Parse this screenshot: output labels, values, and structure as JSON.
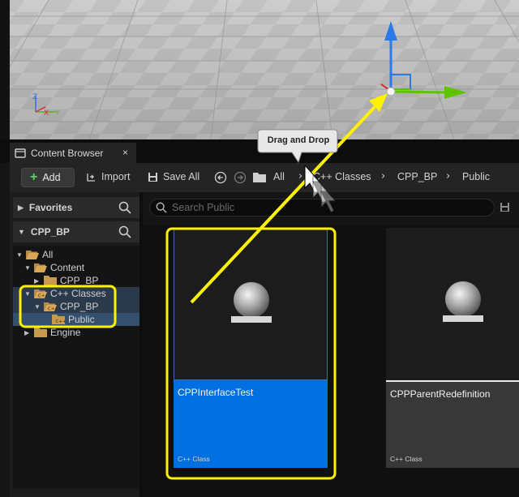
{
  "content_browser": {
    "tab_title": "Content Browser",
    "tab_close": "×"
  },
  "toolbar": {
    "add_label": "Add",
    "import_label": "Import",
    "save_all_label": "Save All",
    "breadcrumbs": [
      "All",
      "C++ Classes",
      "CPP_BP",
      "Public"
    ]
  },
  "sidebar": {
    "favorites_label": "Favorites",
    "project_label": "CPP_BP",
    "tree": [
      {
        "label": "All"
      },
      {
        "label": "Content"
      },
      {
        "label": "CPP_BP"
      },
      {
        "label": "C++ Classes"
      },
      {
        "label": "CPP_BP"
      },
      {
        "label": "Public"
      },
      {
        "label": "Engine"
      }
    ]
  },
  "search": {
    "placeholder": "Search Public"
  },
  "assets": [
    {
      "name": "CPPInterfaceTest",
      "type": "C++ Class"
    },
    {
      "name": "CPPParentRedefinition",
      "type": "C++ Class"
    }
  ],
  "annotation": {
    "callout": "Drag and Drop"
  },
  "colors": {
    "highlight": "#fff200",
    "selected_tile": "#0070e0",
    "tile_label": "#383838",
    "gizmo_z": "#2a7be8",
    "gizmo_x": "#5fc400"
  }
}
